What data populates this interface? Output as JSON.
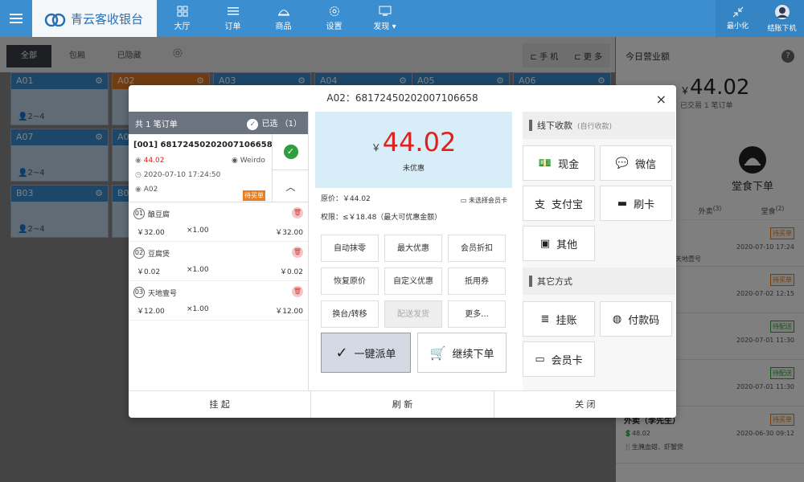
{
  "app": {
    "name": "青云客收银台"
  },
  "nav": [
    {
      "label": "大厅",
      "icon": "grid-icon"
    },
    {
      "label": "订单",
      "icon": "list-icon"
    },
    {
      "label": "商品",
      "icon": "bell-icon"
    },
    {
      "label": "设置",
      "icon": "gear-icon"
    },
    {
      "label": "发现",
      "icon": "monitor-icon"
    }
  ],
  "topright": {
    "minimize": "最小化",
    "logout": "结账下机"
  },
  "tabs": [
    "全部",
    "包厢",
    "已隐藏"
  ],
  "tabs_right": {
    "phone": "手 机",
    "more": "更 多"
  },
  "tables": [
    {
      "name": "A01",
      "seats": "2~4"
    },
    {
      "name": "A02",
      "seats": ""
    },
    {
      "name": "A03",
      "seats": ""
    },
    {
      "name": "A04",
      "seats": ""
    },
    {
      "name": "A05",
      "seats": ""
    },
    {
      "name": "A06",
      "seats": ""
    },
    {
      "name": "A07",
      "seats": "2~4"
    },
    {
      "name": "A0",
      "seats": ""
    },
    {
      "name": "B03",
      "seats": "2~4"
    },
    {
      "name": "B0",
      "seats": ""
    }
  ],
  "revenue": {
    "title": "今日营业额",
    "help": "?",
    "amount": "44.02",
    "sub": "已交易 1 笔订单",
    "btn_left": "单",
    "btn_right": "堂食下单"
  },
  "rp_tabs": [
    {
      "label": "",
      "count": ""
    },
    {
      "label": "外卖",
      "count": "(3)"
    },
    {
      "label": "堂食",
      "count": "(2)"
    }
  ],
  "rp_orders": [
    {
      "badge": "待买单",
      "badge_type": "o",
      "date": "2020-07-10 17:24",
      "line": "煲、天地壹号",
      "title": ""
    },
    {
      "badge": "待买单",
      "badge_type": "o",
      "date": "2020-07-02 12:15",
      "line": "焖肉",
      "title": ""
    },
    {
      "badge": "待配送",
      "badge_type": "g",
      "date": "2020-07-01 11:30",
      "line": "",
      "title": ""
    },
    {
      "badge": "待配送",
      "badge_type": "g",
      "date": "2020-07-01 11:30",
      "line": "",
      "title": ""
    },
    {
      "badge": "待买单",
      "badge_type": "o",
      "date": "2020-06-30 09:12",
      "line": "生腌血蚶、虾蟹煲",
      "title": "外卖（李先生）",
      "amount": "48.02"
    }
  ],
  "modal": {
    "title": "A02：68172450202007106658",
    "close": "×",
    "left_head": "共 1 笔订单",
    "left_selected": "已选 （1）",
    "order": {
      "id": "[001] 68172450202007106658",
      "amount": "44.02",
      "user": "Weirdo",
      "time": "2020-07-10 17:24:50",
      "table": "A02",
      "tag": "待买单"
    },
    "items": [
      {
        "no": "01",
        "name": "酿豆腐",
        "price": "￥32.00",
        "qty": "×1.00",
        "total": "￥32.00"
      },
      {
        "no": "02",
        "name": "豆腐煲",
        "price": "￥0.02",
        "qty": "×1.00",
        "total": "￥0.02"
      },
      {
        "no": "03",
        "name": "天地壹号",
        "price": "￥12.00",
        "qty": "×1.00",
        "total": "￥12.00"
      }
    ],
    "amount": {
      "symbol": "￥",
      "value": "44.02",
      "sub": "未优惠"
    },
    "orig_price": "原价：￥44.02",
    "member": "未选择会员卡",
    "limit": "权限：≤￥18.48（最大可优惠金额）",
    "actions": [
      "自动抹零",
      "最大优惠",
      "会员折扣",
      "恢复原价",
      "自定义优惠",
      "抵用券",
      "换台/转移",
      "配送发货",
      "更多..."
    ],
    "big_buttons": [
      "一键派单",
      "继续下单"
    ],
    "offline_title": "线下收款",
    "offline_sub": "(自行收款)",
    "offline_pay": [
      {
        "label": "现金",
        "icon": "cash-icon"
      },
      {
        "label": "微信",
        "icon": "wechat-icon"
      },
      {
        "label": "支付宝",
        "icon": "alipay-icon"
      },
      {
        "label": "刷卡",
        "icon": "card-icon"
      },
      {
        "label": "其他",
        "icon": "wallet-icon"
      }
    ],
    "other_title": "其它方式",
    "other_pay": [
      {
        "label": "挂账",
        "icon": "ledger-icon"
      },
      {
        "label": "付款码",
        "icon": "qrcode-icon"
      },
      {
        "label": "会员卡",
        "icon": "membercard-icon"
      }
    ],
    "footer": [
      "挂 起",
      "刷 新",
      "关 闭"
    ]
  }
}
